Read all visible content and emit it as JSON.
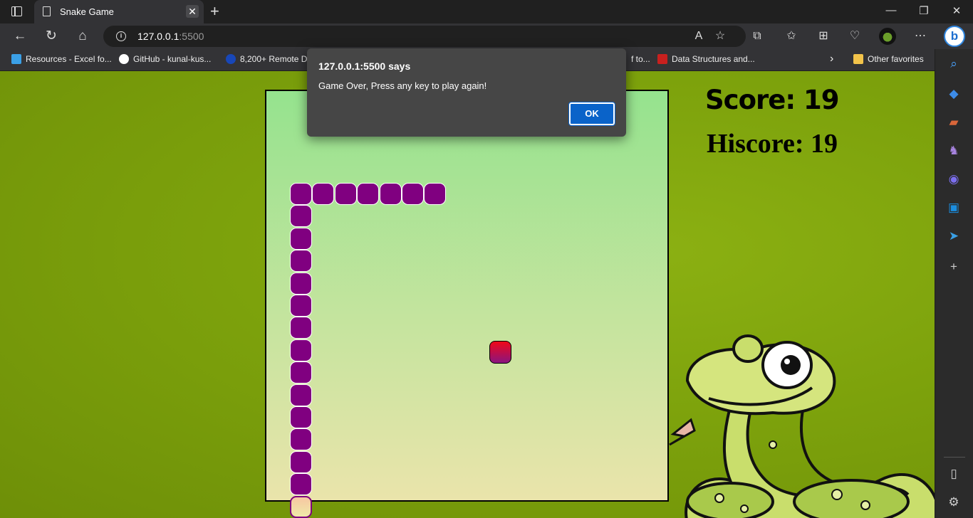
{
  "browser": {
    "tab_title": "Snake Game",
    "tab_close": "✕",
    "new_tab": "+",
    "url_host": "127.0.0.1",
    "url_port": ":5500",
    "window_buttons": [
      "—",
      "❐",
      "✕"
    ]
  },
  "favorites": {
    "items": [
      {
        "label": "Resources - Excel fo...",
        "icon": "excel-rocket-icon"
      },
      {
        "label": "GitHub - kunal-kus...",
        "icon": "github-icon"
      },
      {
        "label": "8,200+ Remote D",
        "icon": "remote-icon"
      },
      {
        "label": "f to...",
        "icon": "partial-icon"
      },
      {
        "label": "Data Structures and...",
        "icon": "pdf-icon"
      }
    ],
    "overflow": "›",
    "other_favorites": "Other favorites"
  },
  "game": {
    "score_label": "Score: 19",
    "hiscore_label": "Hiscore: 19",
    "colors": {
      "snake_body": "#800080",
      "food": "#f00818",
      "board_top": "#95e38e",
      "board_bottom": "#eae4ab"
    }
  },
  "dialog": {
    "title": "127.0.0.1:5500 says",
    "message": "Game Over, Press any key to play again!",
    "ok_label": "OK"
  }
}
